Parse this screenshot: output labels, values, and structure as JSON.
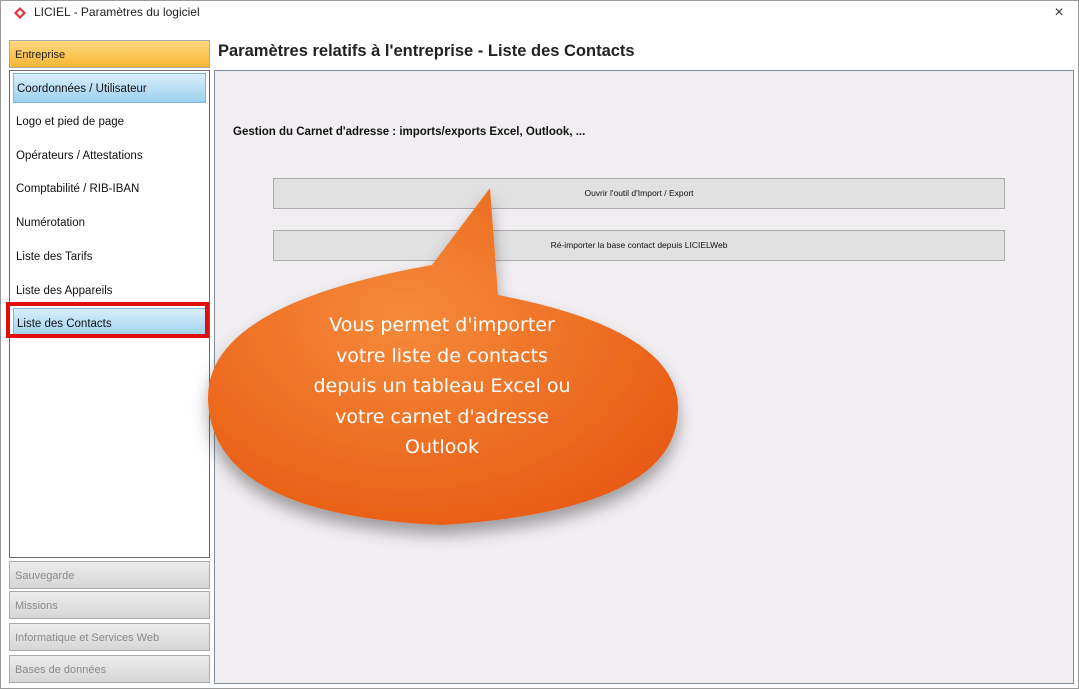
{
  "window": {
    "title": "LICIEL - Paramètres du logiciel",
    "close_glyph": "×",
    "brand_color": "#e2333b"
  },
  "sidebar": {
    "active_group": "Entreprise",
    "items": [
      {
        "label": "Coordonnées / Utilisateur"
      },
      {
        "label": "Logo et pied de page"
      },
      {
        "label": "Opérateurs / Attestations"
      },
      {
        "label": "Comptabilité / RIB-IBAN"
      },
      {
        "label": "Numérotation"
      },
      {
        "label": "Liste des Tarifs"
      },
      {
        "label": "Liste des Appareils"
      },
      {
        "label": "Liste des Contacts",
        "selected": true
      }
    ],
    "collapsed_groups": [
      {
        "label": "Sauvegarde"
      },
      {
        "label": "Missions"
      },
      {
        "label": "Informatique et Services Web"
      },
      {
        "label": "Bases de données"
      }
    ]
  },
  "main": {
    "page_title": "Paramètres relatifs à l'entreprise - Liste des Contacts",
    "section_label": "Gestion du Carnet d'adresse : imports/exports Excel, Outlook, ...",
    "buttons": [
      {
        "label": "Ouvrir l'outil d'Import / Export"
      },
      {
        "label": "Ré-importer la base contact depuis LICIELWeb"
      }
    ]
  },
  "callout": {
    "lines": [
      "Vous permet d'importer",
      "votre liste de contacts",
      "depuis un tableau Excel ou",
      "votre carnet d'adresse",
      "Outlook"
    ],
    "color": "#f26d1f"
  }
}
